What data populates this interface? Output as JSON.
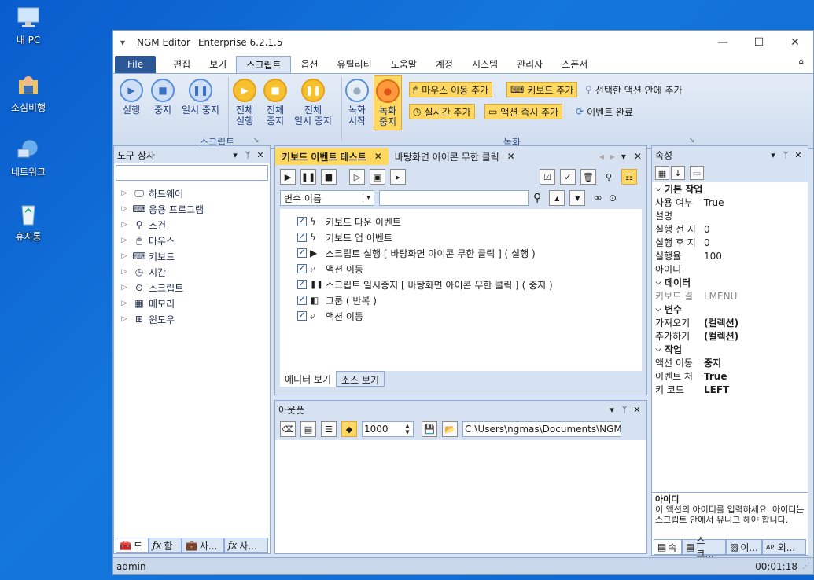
{
  "desktop": {
    "icons": [
      {
        "label": "내 PC"
      },
      {
        "label": "소심비행"
      },
      {
        "label": "네트워크"
      },
      {
        "label": "휴지통"
      }
    ]
  },
  "window": {
    "title": "NGM Editor",
    "edition": "Enterprise 6.2.1.5",
    "quick_access": "▾",
    "minimize": "—",
    "maximize": "☐",
    "close": "✕"
  },
  "menu": {
    "file": "File",
    "items": [
      "편집",
      "보기",
      "스크립트",
      "옵션",
      "유틸리티",
      "도움말",
      "계정",
      "시스템",
      "관리자",
      "스폰서"
    ],
    "active": "스크립트"
  },
  "ribbon": {
    "script_group": {
      "label": "스크립트",
      "buttons": [
        "실행",
        "중지",
        "일시 중지"
      ],
      "all_run": [
        "전체",
        "실행"
      ],
      "all_stop": [
        "전체",
        "중지"
      ],
      "all_pause": [
        "전체",
        "일시 중지"
      ]
    },
    "record_group": {
      "label": "녹화",
      "start": [
        "녹화",
        "시작"
      ],
      "stop": [
        "녹화",
        "중지"
      ],
      "mouse_move": "마우스 이동 추가",
      "keyboard": "키보드 추가",
      "add_in_action": "선택한 액션 안에 추가",
      "realtime": "실시간 추가",
      "action_now": "액션 즉시 추가",
      "event_done": "이벤트 완료"
    }
  },
  "toolbox": {
    "title": "도구 상자",
    "items": [
      "하드웨어",
      "응용 프로그램",
      "조건",
      "마우스",
      "키보드",
      "시간",
      "스크립트",
      "메모리",
      "윈도우"
    ],
    "bottom_tabs": [
      "도",
      "함",
      "사...",
      "사..."
    ]
  },
  "editor": {
    "tabs": [
      "키보드 이벤트 테스트",
      "바탕화면 아이콘 무한 클릭"
    ],
    "filter_select": "변수 이름",
    "events": [
      {
        "label": "키보드 다운 이벤트",
        "icon": "lightning"
      },
      {
        "label": "키보드 업 이벤트",
        "icon": "lightning"
      },
      {
        "label": "스크립트 실행 [ 바탕화면 아이콘 무한 클릭 ] ( 실행 )",
        "icon": "play"
      },
      {
        "label": "액션 이동",
        "icon": "jump"
      },
      {
        "label": "스크립트 일시중지 [ 바탕화면 아이콘 무한 클릭 ] ( 중지 )",
        "icon": "pause"
      },
      {
        "label": "그룹 ( 반복 )",
        "icon": "group"
      },
      {
        "label": "액션 이동",
        "icon": "jump"
      }
    ],
    "view_tabs": [
      "에디터 보기",
      "소스 보기"
    ]
  },
  "output": {
    "title": "아웃풋",
    "interval": "1000",
    "path": "C:\\Users\\ngmas\\Documents\\NGM6\\"
  },
  "properties": {
    "title": "속성",
    "categories": [
      {
        "name": "기본 작업",
        "rows": [
          {
            "k": "사용 여부",
            "v": "True",
            "bold": false
          },
          {
            "k": "설명",
            "v": "",
            "bold": false
          },
          {
            "k": "실행 전 지",
            "v": "0",
            "bold": false
          },
          {
            "k": "실행 후 지",
            "v": "0",
            "bold": false
          },
          {
            "k": "실행율",
            "v": "100",
            "bold": false
          },
          {
            "k": "아이디",
            "v": "",
            "bold": false
          }
        ]
      },
      {
        "name": "데이터",
        "rows": [
          {
            "k": "키보드 결",
            "v": "LMENU",
            "bold": false,
            "grey": true
          }
        ]
      },
      {
        "name": "변수",
        "rows": [
          {
            "k": "가져오기",
            "v": "(컬렉션)",
            "bold": true
          },
          {
            "k": "추가하기",
            "v": "(컬렉션)",
            "bold": true
          }
        ]
      },
      {
        "name": "작업",
        "rows": [
          {
            "k": "액션 이동",
            "v": "중지",
            "bold": true
          },
          {
            "k": "이벤트 처",
            "v": "True",
            "bold": true
          },
          {
            "k": "키 코드",
            "v": "LEFT",
            "bold": true
          }
        ]
      }
    ],
    "help_title": "아이디",
    "help_text": "이 액션의 아이디를 입력하세요. 아이디는 스크립트 안에서 유니크 해야 합니다.",
    "bottom_tabs": [
      "속",
      "스크...",
      "이...",
      "외..."
    ]
  },
  "status": {
    "user": "admin",
    "time": "00:01:18"
  }
}
